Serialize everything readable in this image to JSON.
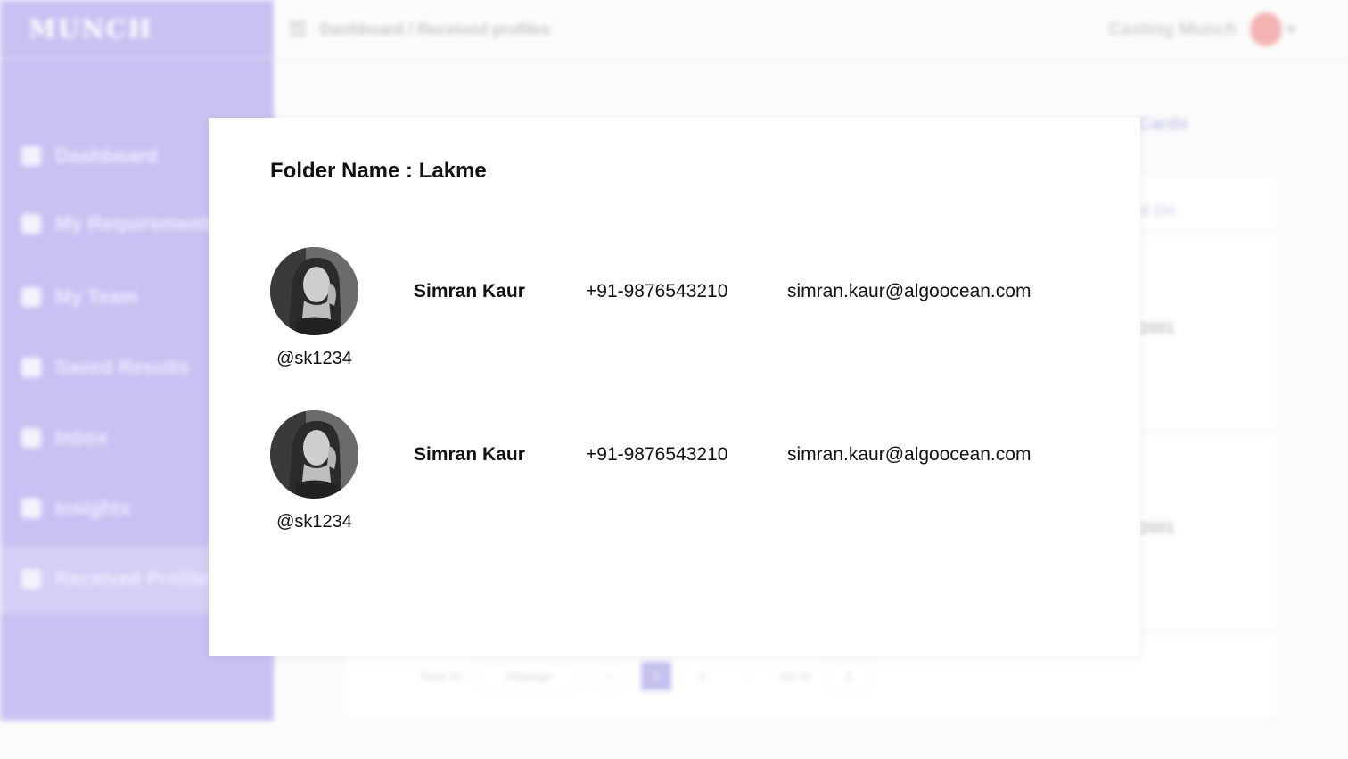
{
  "app": {
    "logo": "MUNCH",
    "breadcrumb": "Dashboard / Received profiles",
    "user_name": "Casting Munch",
    "accent": "#c8c2f2"
  },
  "sidebar": {
    "items": [
      {
        "label": "Dashboard",
        "icon": "dashboard-icon"
      },
      {
        "label": "My Requirements",
        "icon": "clipboard-icon"
      },
      {
        "label": "My Team",
        "icon": "team-icon"
      },
      {
        "label": "Saved Results",
        "icon": "filter-icon"
      },
      {
        "label": "Inbox",
        "icon": "chat-icon"
      },
      {
        "label": "Insights",
        "icon": "chart-icon"
      },
      {
        "label": "Received Profiles",
        "icon": "user-icon"
      }
    ]
  },
  "background": {
    "tab_hint": "Cards",
    "column_hint": "d On",
    "year_hints": [
      "2001",
      "2001"
    ],
    "pagination": {
      "total": "Total 31",
      "page_size": "20/page",
      "pages": [
        "1",
        "2"
      ],
      "goto_label": "Go to",
      "goto_value": "1"
    }
  },
  "modal": {
    "title": "Folder Name : Lakme",
    "profiles": [
      {
        "name": "Simran Kaur",
        "handle": "@sk1234",
        "phone": "+91-9876543210",
        "email": "simran.kaur@algoocean.com"
      },
      {
        "name": "Simran Kaur",
        "handle": "@sk1234",
        "phone": "+91-9876543210",
        "email": "simran.kaur@algoocean.com"
      }
    ]
  }
}
